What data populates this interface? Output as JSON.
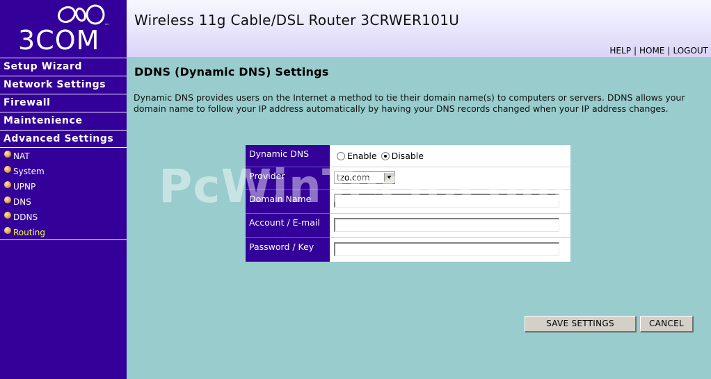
{
  "brand": {
    "logo_text": "3COM",
    "tm": "™"
  },
  "header": {
    "title": "Wireless 11g Cable/DSL Router 3CRWER101U",
    "links": [
      "HELP",
      "HOME",
      "LOGOUT"
    ]
  },
  "sidebar": {
    "main_items": [
      "Setup Wizard",
      "Network Settings",
      "Firewall",
      "Maintenience",
      "Advanced Settings"
    ],
    "sub_items": [
      "NAT",
      "System",
      "UPNP",
      "DNS",
      "DDNS",
      "Routing"
    ],
    "active_sub": "Routing"
  },
  "page": {
    "title": "DDNS (Dynamic DNS) Settings",
    "description": "Dynamic DNS provides users on the Internet a method to tie their domain name(s) to computers or servers. DDNS allows your domain name to follow your IP address automatically by having your DNS records changed when your IP address changes."
  },
  "form": {
    "dynamic_dns_label": "Dynamic DNS",
    "enable_label": "Enable",
    "disable_label": "Disable",
    "dynamic_dns_value": "Disable",
    "provider_label": "Provider",
    "provider_value": "tzo.com",
    "domain_name_label": "Domain Name",
    "domain_name_value": "",
    "account_label": "Account / E-mail",
    "account_value": "",
    "password_label": "Password / Key",
    "password_value": ""
  },
  "buttons": {
    "save": "SAVE SETTINGS",
    "cancel": "CANCEL"
  },
  "watermark": "PcWinTech.com",
  "colors": {
    "sidebar": "#330099",
    "background": "#99cccc",
    "active_nav": "#ffff33"
  }
}
